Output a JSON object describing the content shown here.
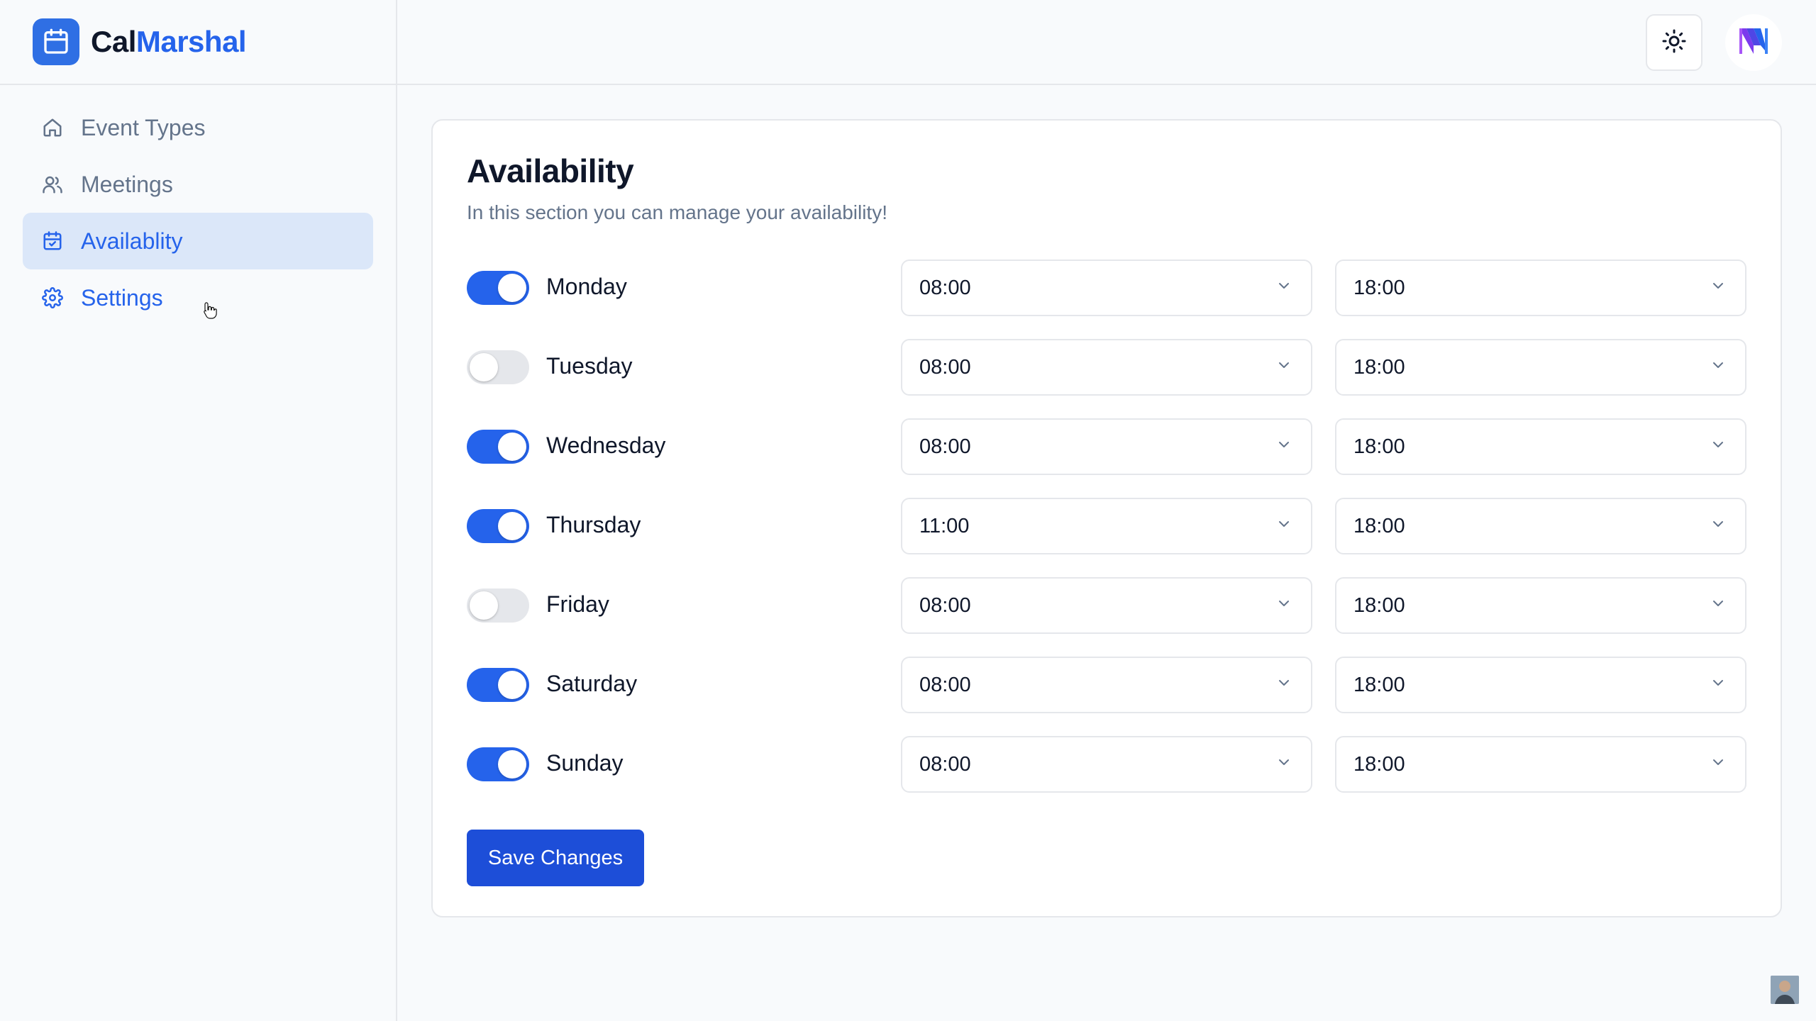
{
  "brand": {
    "part1": "Cal",
    "part2": "Marshal"
  },
  "sidebar": {
    "items": [
      {
        "label": "Event Types",
        "icon": "home-icon"
      },
      {
        "label": "Meetings",
        "icon": "users-icon"
      },
      {
        "label": "Availablity",
        "icon": "calendar-check-icon"
      },
      {
        "label": "Settings",
        "icon": "gear-icon"
      }
    ]
  },
  "header": {
    "theme_icon": "sun-icon",
    "avatar_icon": "user-logo-icon"
  },
  "availability": {
    "title": "Availability",
    "subtitle": "In this section you can manage your availability!",
    "days": [
      {
        "name": "Monday",
        "enabled": true,
        "start": "08:00",
        "end": "18:00"
      },
      {
        "name": "Tuesday",
        "enabled": false,
        "start": "08:00",
        "end": "18:00"
      },
      {
        "name": "Wednesday",
        "enabled": true,
        "start": "08:00",
        "end": "18:00"
      },
      {
        "name": "Thursday",
        "enabled": true,
        "start": "11:00",
        "end": "18:00"
      },
      {
        "name": "Friday",
        "enabled": false,
        "start": "08:00",
        "end": "18:00"
      },
      {
        "name": "Saturday",
        "enabled": true,
        "start": "08:00",
        "end": "18:00"
      },
      {
        "name": "Sunday",
        "enabled": true,
        "start": "08:00",
        "end": "18:00"
      }
    ],
    "save_label": "Save Changes"
  },
  "colors": {
    "accent": "#2563eb",
    "toggle_off": "#e5e7eb",
    "muted": "#64748b"
  }
}
